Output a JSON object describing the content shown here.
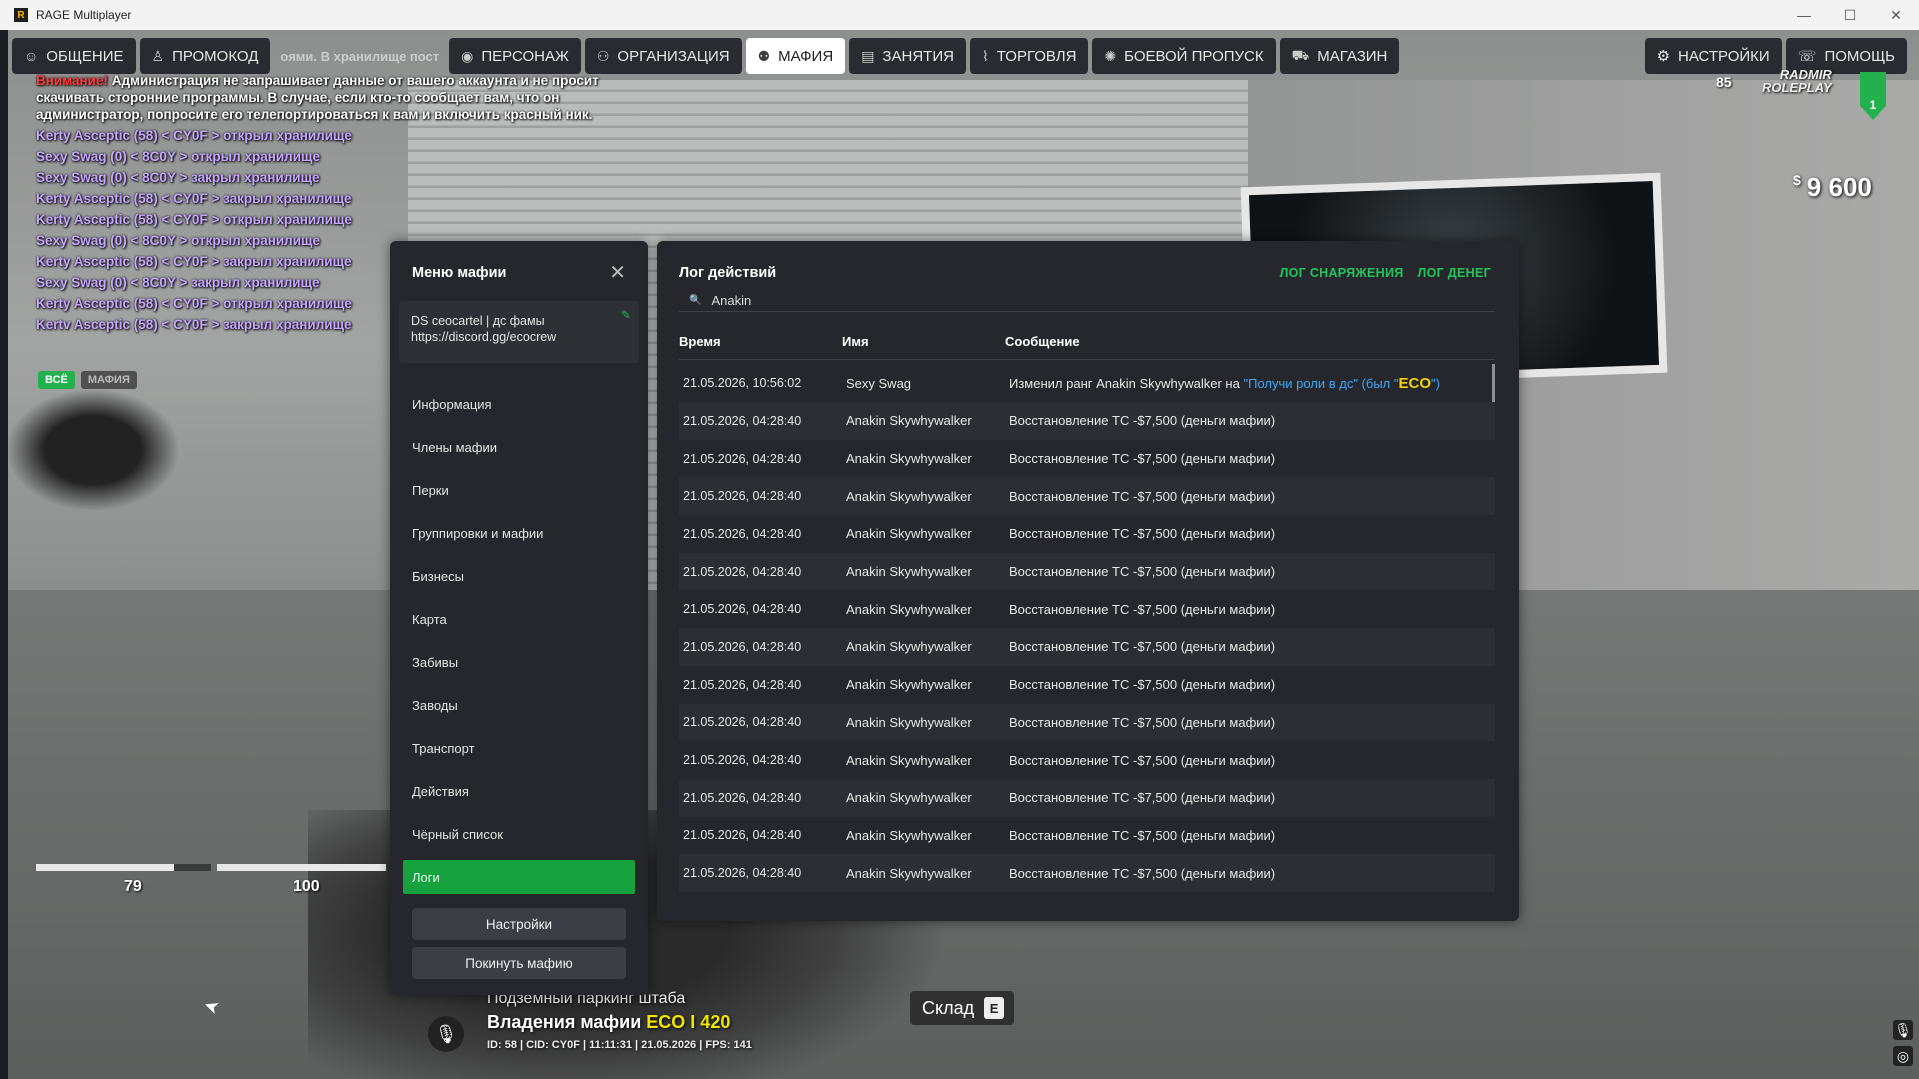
{
  "window": {
    "title": "RAGE Multiplayer",
    "controls": [
      "—",
      "☐",
      "✕"
    ]
  },
  "topnav": {
    "items": [
      {
        "label": "ОБЩЕНИЕ",
        "icon": "chat-icon"
      },
      {
        "label": "ПРОМОКОД",
        "icon": "person-icon"
      },
      {
        "label": "ПЕРСОНАЖ",
        "icon": "user-circle-icon"
      },
      {
        "label": "ОРГАНИЗАЦИЯ",
        "icon": "organization-icon"
      },
      {
        "label": "МАФИЯ",
        "icon": "group-icon"
      },
      {
        "label": "ЗАНЯТИЯ",
        "icon": "clipboard-icon"
      },
      {
        "label": "ТОРГОВЛЯ",
        "icon": "chart-icon"
      },
      {
        "label": "БОЕВОЙ ПРОПУСК",
        "icon": "gear-badge-icon"
      },
      {
        "label": "МАГАЗИН",
        "icon": "cart-icon"
      }
    ],
    "hint": "оями. В хранилище пост",
    "right": [
      {
        "label": "НАСТРОЙКИ",
        "icon": "settings-icon"
      },
      {
        "label": "ПОМОЩЬ",
        "icon": "help-icon"
      }
    ]
  },
  "chat": {
    "warning_label": "Внимание!",
    "warning_text": " Администрация не запрашивает данные от вашего аккаунта и не просит скачивать сторонние программы. В случае, если кто-то сообщает вам, что он администратор, попросите его телепортироваться к вам и включить красный ник.",
    "lines": [
      "Kerty Asceptic (58) < CY0F > открыл хранилище",
      "Sexy Swag (0) < 8C0Y > открыл хранилище",
      "Sexy Swag (0) < 8C0Y > закрыл хранилище",
      "Kerty Asceptic (58) < CY0F > закрыл хранилище",
      "Kerty Asceptic (58) < CY0F > открыл хранилище",
      "Sexy Swag (0) < 8C0Y > открыл хранилище",
      "Kerty Asceptic (58) < CY0F > закрыл хранилище",
      "Sexy Swag (0) < 8C0Y > закрыл хранилище",
      "Kerty Asceptic (58) < CY0F > открыл хранилище",
      "Kertv Asceptic (58) < CY0F > закрыл хранилище"
    ],
    "tabs": {
      "all": "ВСЁ",
      "mafia": "МАФИЯ"
    }
  },
  "hud": {
    "money_currency": "$",
    "money": "9 600",
    "logo_line1": "RADMIR",
    "logo_line2": "ROLEPLAY",
    "server_number": "1",
    "hunger": "85",
    "bar1_value": "79",
    "bar2_value": "100",
    "bar1_fraction": 0.79,
    "bar2_fraction": 1.0,
    "zone": "Подземный паркинг штаба",
    "territory_prefix": "Владения мафии ",
    "territory_name": "ECO I 420",
    "status_line": "ID: 58 | CID: CY0F | 11:11:31    | 21.05.2026 | FPS: 141",
    "storage_label": "Склад",
    "storage_key": "E"
  },
  "mafia_menu": {
    "title": "Меню мафии",
    "motd_line1": "DS ceocartel | дс фамы",
    "motd_line2": "https://discord.gg/ecocrew",
    "items": [
      "Информация",
      "Члены мафии",
      "Перки",
      "Группировки и мафии",
      "Бизнесы",
      "Карта",
      "Забивы",
      "Заводы",
      "Транспорт",
      "Действия",
      "Чёрный список"
    ],
    "active_item": "Логи",
    "settings_button": "Настройки",
    "leave_button": "Покинуть мафию"
  },
  "log_panel": {
    "title": "Лог действий",
    "link_equipment": "ЛОГ СНАРЯЖЕНИЯ",
    "link_money": "ЛОГ ДЕНЕГ",
    "search_value": "Anakin",
    "columns": [
      "Время",
      "Имя",
      "Сообщение"
    ],
    "first_row": {
      "time": "21.05.2026, 10:56:02",
      "name": "Sexy Swag",
      "msg_prefix": "Изменил ранг Anakin Skywhywalker на ",
      "msg_new_rank": "\"Получи роли в дс\" (был \"",
      "msg_old_rank": "ECO",
      "msg_suffix": "\")"
    },
    "rows": [
      {
        "time": "21.05.2026, 04:28:40",
        "name": "Anakin Skywhywalker",
        "message": "Восстановление ТС -$7,500 (деньги мафии)"
      },
      {
        "time": "21.05.2026, 04:28:40",
        "name": "Anakin Skywhywalker",
        "message": "Восстановление ТС -$7,500 (деньги мафии)"
      },
      {
        "time": "21.05.2026, 04:28:40",
        "name": "Anakin Skywhywalker",
        "message": "Восстановление ТС -$7,500 (деньги мафии)"
      },
      {
        "time": "21.05.2026, 04:28:40",
        "name": "Anakin Skywhywalker",
        "message": "Восстановление ТС -$7,500 (деньги мафии)"
      },
      {
        "time": "21.05.2026, 04:28:40",
        "name": "Anakin Skywhywalker",
        "message": "Восстановление ТС -$7,500 (деньги мафии)"
      },
      {
        "time": "21.05.2026, 04:28:40",
        "name": "Anakin Skywhywalker",
        "message": "Восстановление ТС -$7,500 (деньги мафии)"
      },
      {
        "time": "21.05.2026, 04:28:40",
        "name": "Anakin Skywhywalker",
        "message": "Восстановление ТС -$7,500 (деньги мафии)"
      },
      {
        "time": "21.05.2026, 04:28:40",
        "name": "Anakin Skywhywalker",
        "message": "Восстановление ТС -$7,500 (деньги мафии)"
      },
      {
        "time": "21.05.2026, 04:28:40",
        "name": "Anakin Skywhywalker",
        "message": "Восстановление ТС -$7,500 (деньги мафии)"
      },
      {
        "time": "21.05.2026, 04:28:40",
        "name": "Anakin Skywhywalker",
        "message": "Восстановление ТС -$7,500 (деньги мафии)"
      },
      {
        "time": "21.05.2026, 04:28:40",
        "name": "Anakin Skywhywalker",
        "message": "Восстановление ТС -$7,500 (деньги мафии)"
      },
      {
        "time": "21.05.2026, 04:28:40",
        "name": "Anakin Skywhywalker",
        "message": "Восстановление ТС -$7,500 (деньги мафии)"
      },
      {
        "time": "21.05.2026, 04:28:40",
        "name": "Anakin Skywhywalker",
        "message": "Восстановление ТС -$7,500 (деньги мафии)"
      }
    ]
  },
  "colors": {
    "accent_green": "#16a33f",
    "link_green": "#22c55e",
    "panel_bg": "#25272c",
    "rank_blue": "#3fa9f5",
    "eco_yellow": "#f2d200",
    "chat_purple": "#c5a6ff"
  }
}
